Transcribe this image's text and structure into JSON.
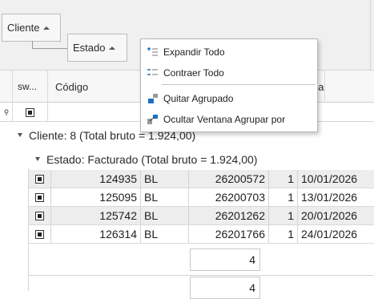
{
  "group_panel": {
    "groups": [
      {
        "label": "Cliente"
      },
      {
        "label": "Estado"
      }
    ]
  },
  "columns": {
    "selection": "sw...",
    "codigo": "Código",
    "fecha_partial": "ha"
  },
  "groups": {
    "cliente_row": "Cliente: 8 (Total bruto = 1.924,00)",
    "estado_row": "Estado: Facturado (Total bruto = 1.924,00)"
  },
  "rows": [
    {
      "codigo": "124935",
      "tipo": "BL",
      "numero": "26200572",
      "qty": "1",
      "fecha": "10/01/2026"
    },
    {
      "codigo": "125095",
      "tipo": "BL",
      "numero": "26200703",
      "qty": "1",
      "fecha": "13/01/2026"
    },
    {
      "codigo": "125742",
      "tipo": "BL",
      "numero": "26201262",
      "qty": "1",
      "fecha": "20/01/2026"
    },
    {
      "codigo": "126314",
      "tipo": "BL",
      "numero": "26201766",
      "qty": "1",
      "fecha": "24/01/2026"
    }
  ],
  "summaries": {
    "estado_count": "4",
    "cliente_count": "4"
  },
  "context_menu": {
    "items": [
      {
        "label": "Expandir Todo",
        "icon": "expand-all-icon"
      },
      {
        "label": "Contraer Todo",
        "icon": "collapse-all-icon"
      },
      {
        "label": "Quitar Agrupado",
        "icon": "ungroup-icon"
      },
      {
        "label": "Ocultar Ventana Agrupar por",
        "icon": "hide-group-panel-icon"
      }
    ]
  },
  "colors": {
    "accent": "#1f6fc6",
    "alt_row": "#ededed",
    "panel_bg": "#f0f0f0"
  }
}
